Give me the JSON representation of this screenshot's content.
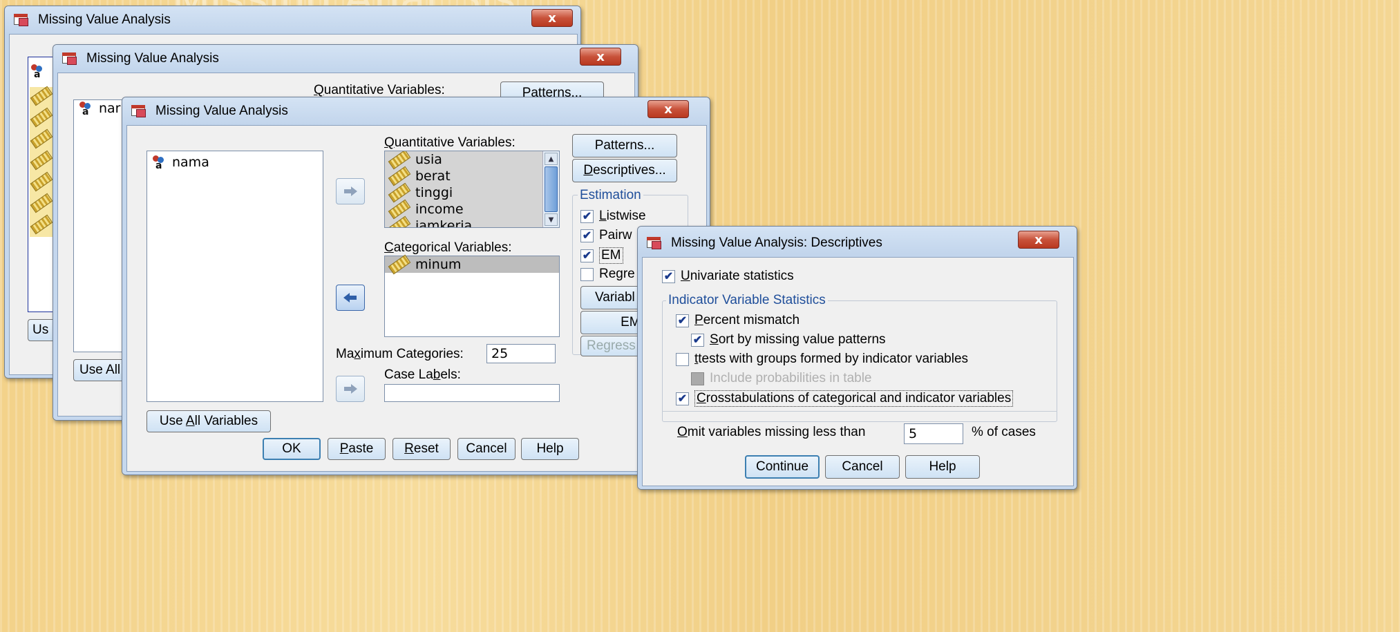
{
  "background_title": "Missing Anal Sis",
  "dialogs": {
    "back": {
      "title": "Missing Value Analysis",
      "close": "x",
      "use_all_label": "Us"
    },
    "middle": {
      "title": "Missing Value Analysis",
      "close": "x",
      "quantitative_label": "Quantitative Variables:",
      "patterns_label": "Patterns...",
      "var_partial": "nar",
      "use_all_label": "Use All"
    },
    "front": {
      "title": "Missing Value Analysis",
      "close": "x",
      "available_variables": [
        "nama"
      ],
      "quantitative_label": "Quantitative Variables:",
      "quantitative_variables": [
        "usia",
        "berat",
        "tinggi",
        "income",
        "jamkerja"
      ],
      "categorical_label": "Categorical Variables:",
      "categorical_variables": [
        "minum"
      ],
      "max_categories_label": "Maximum Categories:",
      "max_categories_value": "25",
      "case_labels_label": "Case Labels:",
      "case_labels_value": "",
      "patterns_label": "Patterns...",
      "descriptives_label": "Descriptives...",
      "estimation_label": "Estimation",
      "estimation_options": [
        {
          "label": "Listwise",
          "checked": true
        },
        {
          "label": "Pairw",
          "checked": true
        },
        {
          "label": "EM",
          "checked": true
        },
        {
          "label": "Regre",
          "checked": false
        }
      ],
      "variables_button": "Variabl",
      "em_button": "EM.",
      "regression_button": "Regress",
      "use_all_label": "Use All Variables",
      "buttons": {
        "ok": "OK",
        "paste": "Paste",
        "reset": "Reset",
        "cancel": "Cancel",
        "help": "Help"
      }
    },
    "descriptives": {
      "title": "Missing Value Analysis: Descriptives",
      "close": "x",
      "univariate": {
        "label": "Univariate statistics",
        "checked": true
      },
      "indicator_group_label": "Indicator Variable Statistics",
      "percent_mismatch": {
        "label": "Percent mismatch",
        "checked": true
      },
      "sort_patterns": {
        "label": "Sort by missing value patterns",
        "checked": true
      },
      "t_tests": {
        "label": "t tests with groups formed by indicator variables",
        "checked": false
      },
      "include_prob": {
        "label": "Include probabilities in table",
        "checked": false
      },
      "crosstabs": {
        "label": "Crosstabulations of categorical and indicator variables",
        "checked": true
      },
      "omit_label": "Omit variables missing less than",
      "omit_value": "5",
      "omit_suffix": "% of cases",
      "buttons": {
        "continue": "Continue",
        "cancel": "Cancel",
        "help": "Help"
      }
    }
  },
  "colors": {
    "close_red": "#c8523a",
    "title_blue": "#c2d5ec",
    "accent_blue": "#1f4e9a"
  }
}
